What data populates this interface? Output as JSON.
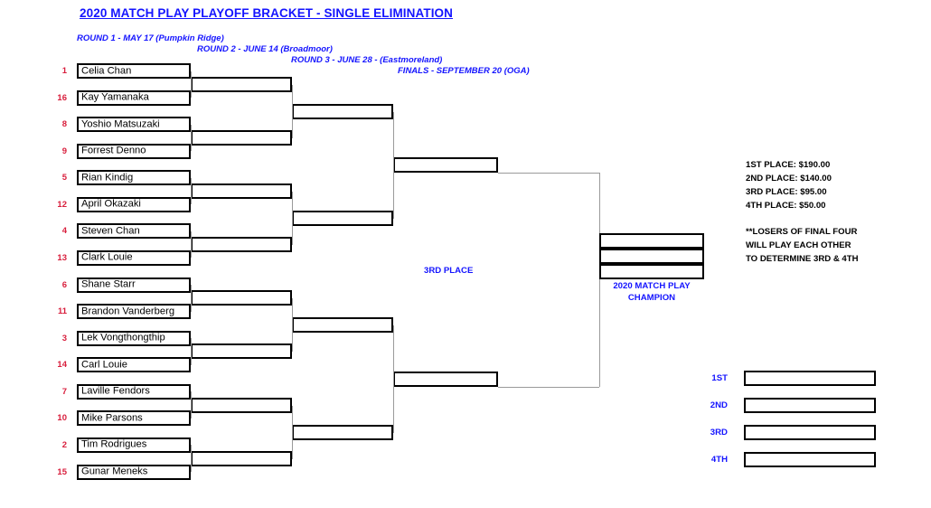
{
  "header": {
    "title": "2020 MATCH PLAY PLAYOFF BRACKET - SINGLE ELIMINATION",
    "rounds": [
      "ROUND 1 - MAY 17 (Pumpkin Ridge)",
      "ROUND 2 - JUNE 14 (Broadmoor)",
      "ROUND 3 - JUNE 28 - (Eastmoreland)",
      "FINALS - SEPTEMBER 20 (OGA)"
    ]
  },
  "bracket": {
    "round1": [
      {
        "seed": "1",
        "name": "Celia Chan"
      },
      {
        "seed": "16",
        "name": "Kay Yamanaka"
      },
      {
        "seed": "8",
        "name": "Yoshio Matsuzaki"
      },
      {
        "seed": "9",
        "name": "Forrest Denno"
      },
      {
        "seed": "5",
        "name": "Rian Kindig"
      },
      {
        "seed": "12",
        "name": "April Okazaki"
      },
      {
        "seed": "4",
        "name": "Steven Chan"
      },
      {
        "seed": "13",
        "name": "Clark Louie"
      },
      {
        "seed": "6",
        "name": "Shane Starr"
      },
      {
        "seed": "11",
        "name": "Brandon Vanderberg"
      },
      {
        "seed": "3",
        "name": "Lek Vongthongthip"
      },
      {
        "seed": "14",
        "name": "Carl Louie"
      },
      {
        "seed": "7",
        "name": "Laville Fendors"
      },
      {
        "seed": "10",
        "name": "Mike Parsons"
      },
      {
        "seed": "2",
        "name": "Tim Rodrigues"
      },
      {
        "seed": "15",
        "name": "Gunar Meneks"
      }
    ],
    "round2": [
      "",
      "",
      "",
      "",
      "",
      "",
      "",
      ""
    ],
    "round3": [
      "",
      "",
      "",
      ""
    ],
    "semifinals": [
      "",
      ""
    ],
    "champion_slots": [
      "",
      "",
      ""
    ],
    "champion_label": "2020 MATCH PLAY CHAMPION",
    "third_place_label": "3RD PLACE"
  },
  "payouts": {
    "lines": [
      "1ST PLACE: $190.00",
      "2ND PLACE: $140.00",
      "3RD PLACE: $95.00",
      "4TH PLACE: $50.00"
    ]
  },
  "notes": {
    "lines": [
      "**LOSERS OF FINAL FOUR",
      "WILL PLAY EACH OTHER",
      "TO DETERMINE 3RD & 4TH"
    ]
  },
  "placements": {
    "rows": [
      {
        "label": "1ST",
        "value": ""
      },
      {
        "label": "2ND",
        "value": ""
      },
      {
        "label": "3RD",
        "value": ""
      },
      {
        "label": "4TH",
        "value": ""
      }
    ]
  },
  "colors": {
    "accent_blue": "#1414ff",
    "seed_red": "#d81e3c",
    "box_border": "#000000",
    "connector": "#9a9a9a"
  }
}
